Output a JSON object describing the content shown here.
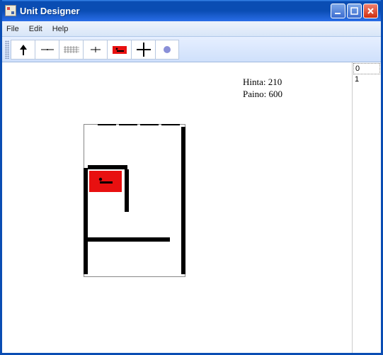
{
  "window": {
    "title": "Unit Designer"
  },
  "menu": {
    "file": "File",
    "edit": "Edit",
    "help": "Help"
  },
  "toolbar": {
    "icons": {
      "arrow": "arrow-up-icon",
      "hseg": "horiz-seg-icon",
      "grid": "grid-pattern-icon",
      "cross": "cross-small-icon",
      "redbox": "red-unit-icon",
      "plus": "plus-large-icon",
      "dot": "dot-icon"
    }
  },
  "info": {
    "price_label": "Hinta:",
    "price_value": "210",
    "weight_label": "Paino:",
    "weight_value": "600"
  },
  "sidelist": {
    "items": [
      "0",
      "1"
    ]
  }
}
